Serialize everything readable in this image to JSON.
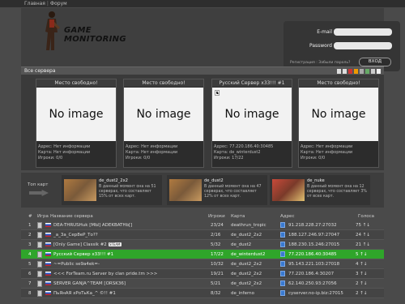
{
  "nav": {
    "home": "Главная",
    "sep": "|",
    "forum": "Форум"
  },
  "logo": {
    "line1": "GAME",
    "line2": "MONITORING"
  },
  "login": {
    "email_label": "E-mail",
    "password_label": "Password",
    "register": "Регистрация : Забыли пароль?",
    "submit": "ВХОД"
  },
  "section": {
    "title": "Все сервера"
  },
  "cards": [
    {
      "title": "Место свободно!",
      "image": "No image",
      "address": "Адрес: Нет информации",
      "map": "Карта: Нет информации",
      "players": "Игроки: 0/0"
    },
    {
      "title": "Место свободно!",
      "image": "No image",
      "address": "Адрес: Нет информации",
      "map": "Карта: Нет информации",
      "players": "Игроки: 0/0"
    },
    {
      "title": "Русский Сервер x33!!! #1",
      "image": "No image",
      "address": "Адрес: 77.220.186.40:30485",
      "map": "Карта: de_winterdust2",
      "players": "Игроки: 17/22"
    },
    {
      "title": "Место свободно!",
      "image": "No image",
      "address": "Адрес: Нет информации",
      "map": "Карта: Нет информации",
      "players": "Игроки: 0/0"
    }
  ],
  "top_maps": {
    "label": "Топ карт",
    "items": [
      {
        "name": "de_dust2_2x2",
        "desc": "В данный момент она на 51 серверах, что составляет 15% от всех карт."
      },
      {
        "name": "de_dust2",
        "desc": "В данный момент она на 47 серверах, что составляет 12% от всех карт."
      },
      {
        "name": "de_nuke",
        "desc": "В данный момент она на 12 серверах, что составляет 3% от всех карт."
      }
    ]
  },
  "table": {
    "headers": {
      "num": "#",
      "game": "Игра",
      "name": "Название сервера",
      "players": "Игроки",
      "map": "Карта",
      "address": "Адрес",
      "votes": "Голоса"
    },
    "rows": [
      {
        "num": "1",
        "name": "DEA-THRUSHuk [МЫ] ADEKBATHb[]",
        "players": "23/24",
        "map": "deathrun_tropic",
        "address": "91.218.228.27:27032",
        "votes": "75 ↑↓"
      },
      {
        "num": "2",
        "name": "_a_3a_Cep8eP_Tо??",
        "players": "2/16",
        "map": "de_dust2_2x2",
        "address": "188.127.246.97:27047",
        "votes": "24 ↑↓"
      },
      {
        "num": "3",
        "name": "[Only Game] Classik #2",
        "badge": "STEAM",
        "players": "5/32",
        "map": "de_dust2",
        "address": "188.230.15.246:27015",
        "votes": "21 ↑↓"
      },
      {
        "num": "4",
        "name": "Русский Сервер x33!!! #1",
        "players": "17/22",
        "map": "de_winterdust2",
        "address": "77.220.186.40:30485",
        "votes": "5 ↑↓"
      },
      {
        "num": "5",
        "name": "~=Public se9a4ek=-",
        "players": "10/32",
        "map": "de_dust2_2x2",
        "address": "95.143.221.103:27018",
        "votes": "4 ↑↓"
      },
      {
        "num": "6",
        "name": "<<< ForTeam.ru Server by clan pride.tm >>>",
        "players": "19/21",
        "map": "de_dust2_2x2",
        "address": "77.220.186.4:30207",
        "votes": "3 ↑↓"
      },
      {
        "num": "7",
        "name": "SERVER GANJA^TEAM [ORSK36]",
        "players": "5/21",
        "map": "de_dust2_2x2",
        "address": "62.140.250.93:27056",
        "votes": "2 ↑↓"
      },
      {
        "num": "8",
        "name": "ПьЯнАЯ хРоТьКа_^ ©!! #1",
        "players": "8/32",
        "map": "de_inferno",
        "address": "cyserver.no-ip.biz:27015",
        "votes": "2 ↑↓"
      }
    ]
  }
}
